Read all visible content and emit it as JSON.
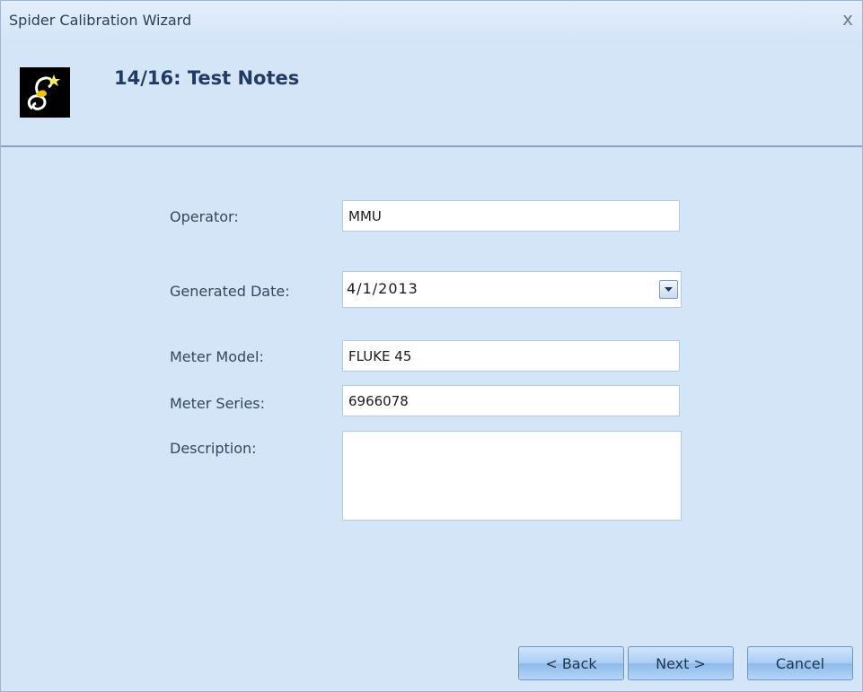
{
  "window": {
    "title": "Spider Calibration Wizard",
    "close_symbol": "x"
  },
  "header": {
    "step_title": "14/16: Test Notes",
    "icon": "spider-wizard-logo-icon"
  },
  "form": {
    "operator": {
      "label": "Operator:",
      "value": "MMU"
    },
    "generated_date": {
      "label": "Generated Date:",
      "value": "4/1/2013"
    },
    "meter_model": {
      "label": "Meter Model:",
      "value": "FLUKE 45"
    },
    "meter_series": {
      "label": "Meter Series:",
      "value": "6966078"
    },
    "description": {
      "label": "Description:",
      "value": ""
    }
  },
  "buttons": {
    "back": "< Back",
    "next": "Next >",
    "cancel": "Cancel"
  },
  "colors": {
    "background": "#d5e5f8",
    "title_text": "#213b64",
    "button_gradient_mid": "#a9cdf3"
  }
}
